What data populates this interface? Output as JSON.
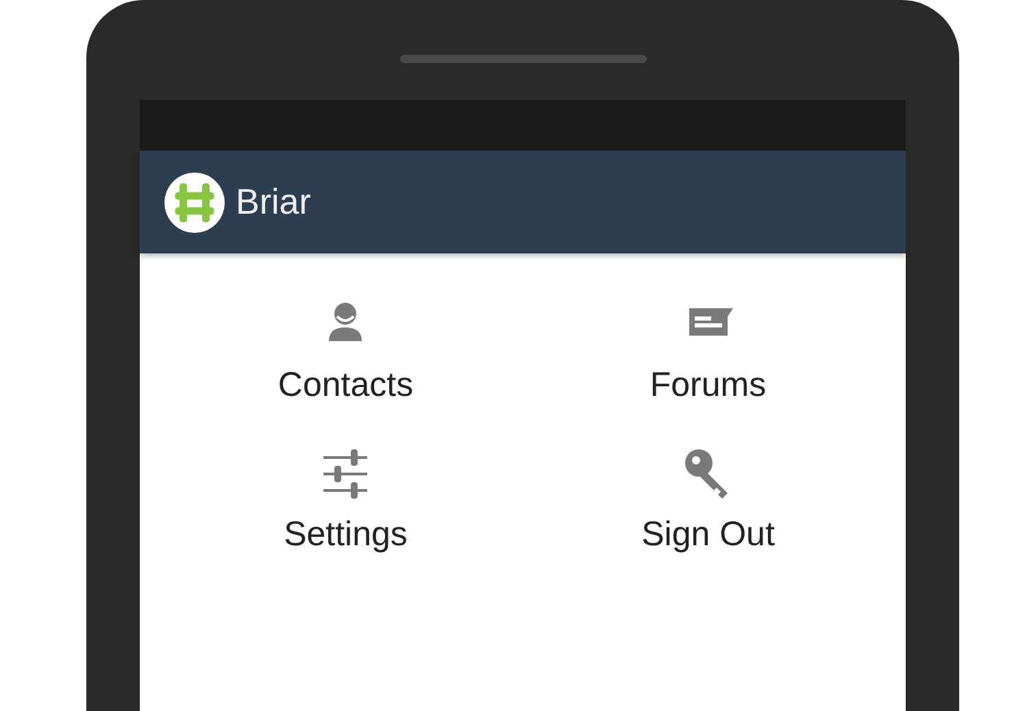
{
  "app_bar": {
    "title": "Briar"
  },
  "menu": [
    {
      "kind": "contacts",
      "label": "Contacts"
    },
    {
      "kind": "forums",
      "label": "Forums"
    },
    {
      "kind": "settings",
      "label": "Settings"
    },
    {
      "kind": "signout",
      "label": "Sign Out"
    }
  ]
}
